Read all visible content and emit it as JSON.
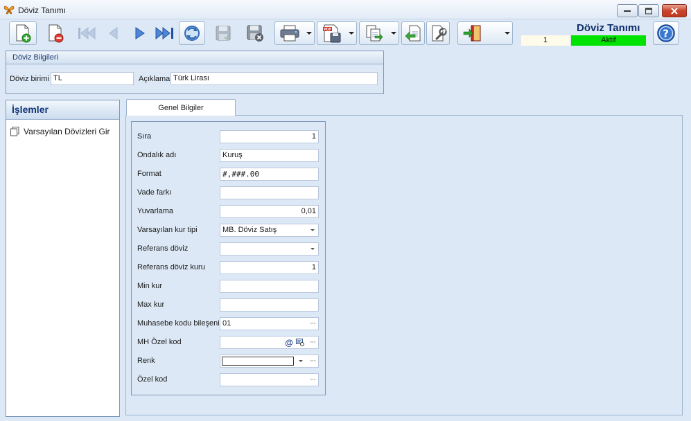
{
  "window": {
    "title": "Döviz Tanımı"
  },
  "header": {
    "title": "Döviz Tanımı",
    "record_no": "1",
    "status": "Aktif",
    "status_color": "#00e300"
  },
  "toolbar": {
    "buttons": [
      {
        "icon": "new-document-icon"
      },
      {
        "icon": "delete-document-icon"
      },
      {
        "icon": "first-record-icon"
      },
      {
        "icon": "previous-record-icon"
      },
      {
        "icon": "next-record-icon"
      },
      {
        "icon": "last-record-icon"
      },
      {
        "icon": "refresh-icon"
      },
      {
        "icon": "save-icon"
      },
      {
        "icon": "cancel-save-icon"
      },
      {
        "icon": "print-icon"
      },
      {
        "icon": "pdf-export-icon"
      },
      {
        "icon": "copy-icon"
      },
      {
        "icon": "import-icon"
      },
      {
        "icon": "tools-icon"
      },
      {
        "icon": "exit-icon"
      },
      {
        "icon": "help-icon"
      }
    ]
  },
  "currency_info": {
    "group_title": "Döviz Bilgileri",
    "unit_label": "Döviz birimi",
    "unit_value": "TL",
    "description_label": "Açıklama",
    "description_value": "Türk Lirası"
  },
  "side_panel": {
    "title": "İşlemler",
    "items": [
      {
        "label": "Varsayılan Dövizleri Gir"
      }
    ]
  },
  "tabs": [
    {
      "label": "Genel Bilgiler",
      "active": true
    }
  ],
  "general": {
    "fields": [
      {
        "label": "Sıra",
        "value": "1"
      },
      {
        "label": "Ondalık adı",
        "value": "Kuruş"
      },
      {
        "label": "Format",
        "value": "#,###.00"
      },
      {
        "label": "Vade farkı",
        "value": ""
      },
      {
        "label": "Yuvarlama",
        "value": "0,01"
      },
      {
        "label": "Varsayılan kur tipi",
        "value": "MB. Döviz Satış"
      },
      {
        "label": "Referans döviz",
        "value": ""
      },
      {
        "label": "Referans döviz kuru",
        "value": "1"
      },
      {
        "label": "Min kur",
        "value": ""
      },
      {
        "label": "Max kur",
        "value": ""
      },
      {
        "label": "Muhasebe kodu bileşeni",
        "value": "01"
      },
      {
        "label": "MH Özel kod",
        "value": ""
      },
      {
        "label": "Renk",
        "value": ""
      },
      {
        "label": "Özel kod",
        "value": ""
      }
    ]
  }
}
